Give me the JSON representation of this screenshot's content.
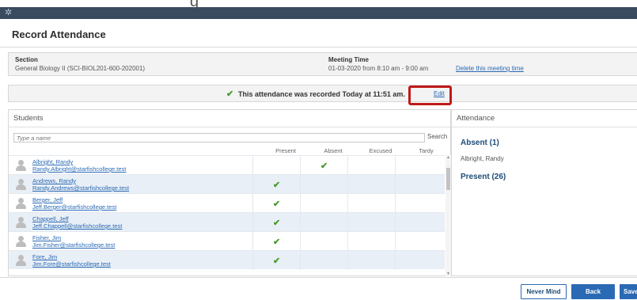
{
  "app": {
    "logo_glyph": "✲"
  },
  "dialog": {
    "title": "Record Attendance"
  },
  "section": {
    "label": "Section",
    "value": "General Biology II (SCI-BIOL201-600-202001)"
  },
  "meeting": {
    "label": "Meeting Time",
    "value": "01-03-2020 from 8:10 am - 9:00 am",
    "delete_link": "Delete this meeting time"
  },
  "status": {
    "message": "This attendance was recorded Today at 11:51 am.",
    "edit_link": "Edit",
    "check_glyph": "✔"
  },
  "students_panel": {
    "title": "Students",
    "search_placeholder": "Type a name",
    "search_button": "Search",
    "columns": [
      "Present",
      "Absent",
      "Excused",
      "Tardy"
    ],
    "rows": [
      {
        "name": "Albright, Randy",
        "email": "Randy.Albright@starfishcollege.test",
        "status": "Absent"
      },
      {
        "name": "Andrews, Randy",
        "email": "Randy.Andrews@starfishcollege.test",
        "status": "Present"
      },
      {
        "name": "Berger, Jeff",
        "email": "Jeff.Berger@starfishcollege.test",
        "status": "Present"
      },
      {
        "name": "Chappell, Jeff",
        "email": "Jeff.Chappell@starfishcollege.test",
        "status": "Present"
      },
      {
        "name": "Fisher, Jim",
        "email": "Jim.Fisher@starfishcollege.test",
        "status": "Present"
      },
      {
        "name": "Fore, Jim",
        "email": "Jim.Fore@starfishcollege.test",
        "status": "Present"
      }
    ]
  },
  "attendance_panel": {
    "title": "Attendance",
    "absent_title": "Absent (1)",
    "absent_names": [
      "Albright, Randy"
    ],
    "present_title": "Present (26)"
  },
  "footer": {
    "never_mind": "Never Mind",
    "back": "Back",
    "save": "Save"
  },
  "colors": {
    "accent": "#2a6ab5",
    "check": "#4a9a2e",
    "highlight": "#c11a1a",
    "header_bar": "#3a4a5f"
  }
}
